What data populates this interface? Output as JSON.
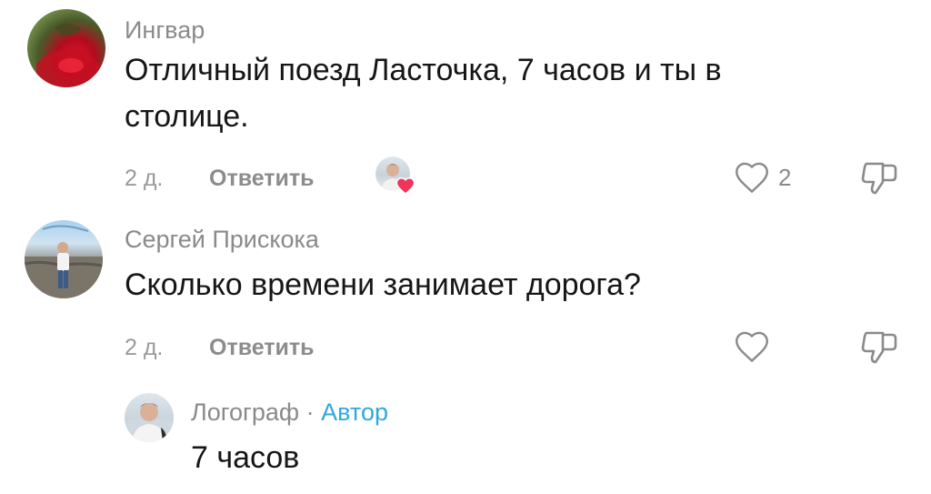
{
  "comments": [
    {
      "author": "Ингвар",
      "text_line1": "Отличный поезд Ласточка, 7 часов и ты в",
      "text_line2": "столице.",
      "time": "2 д.",
      "reply_label": "Ответить",
      "like_count": "2",
      "has_author_heart": true
    },
    {
      "author": "Сергей Прискока",
      "text": "Сколько времени занимает дорога?",
      "time": "2 д.",
      "reply_label": "Ответить",
      "like_count": ""
    }
  ],
  "reply": {
    "author": "Логограф",
    "separator": "·",
    "badge": "Автор",
    "text": "7 часов"
  },
  "icons": {
    "like": "heart-outline-icon",
    "dislike": "thumbs-down-outline-icon",
    "author_heart": "red-heart-icon"
  },
  "colors": {
    "author_badge": "#2fa8de",
    "heart_red": "#f0345a",
    "muted_text": "#8a8a8a"
  }
}
